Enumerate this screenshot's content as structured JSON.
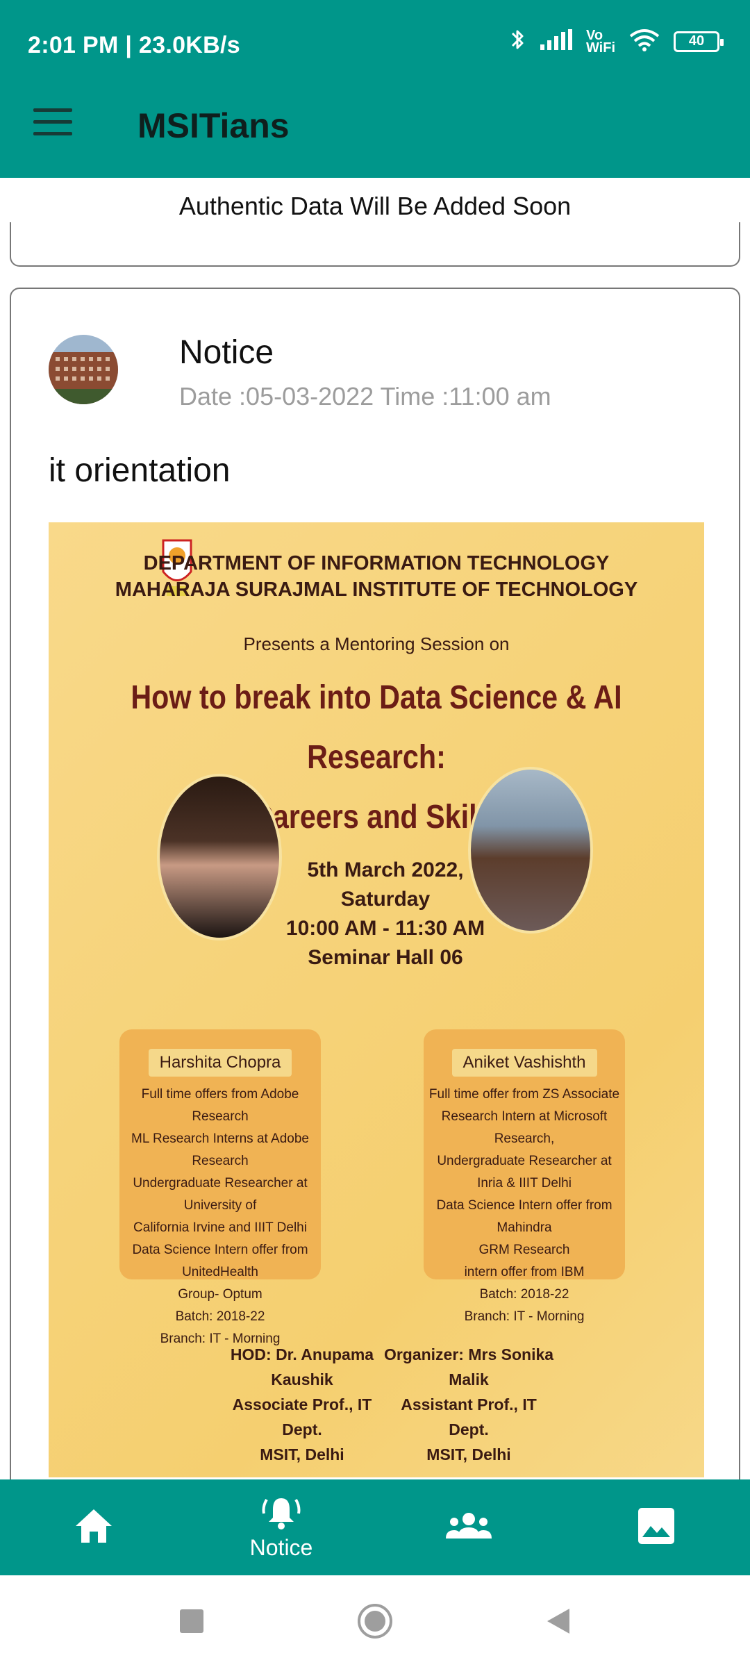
{
  "status_bar": {
    "time_speed": "2:01 PM | 23.0KB/s",
    "vowifi_top": "Vo",
    "vowifi_bottom": "WiFi",
    "battery": "40"
  },
  "app_bar": {
    "title": "MSITians",
    "menu_icon": "hamburger-menu-icon"
  },
  "banner": {
    "text": "Authentic Data Will Be Added Soon"
  },
  "notice_card": {
    "title": "Notice",
    "date": "Date :05-03-2022 Time :11:00 am",
    "body": "it orientation",
    "poster": {
      "dept_line1": "DEPARTMENT OF INFORMATION TECHNOLOGY",
      "dept_line2": "MAHARAJA SURAJMAL INSTITUTE OF TECHNOLOGY",
      "presents": "Presents a Mentoring Session on",
      "headline1": "How to break into Data Science & AI Research:",
      "headline2": "Careers and Skills",
      "date": "5th March 2022, Saturday",
      "time": "10:00 AM - 11:30 AM",
      "venue": "Seminar Hall 06",
      "speaker_left": {
        "name": "Harshita Chopra",
        "lines": [
          "Full time offers from Adobe Research",
          "ML Research Interns at Adobe Research",
          "Undergraduate Researcher at University of",
          "California Irvine and IIIT Delhi",
          "Data Science Intern offer from UnitedHealth",
          "Group- Optum",
          "Batch: 2018-22",
          "Branch: IT - Morning"
        ]
      },
      "speaker_right": {
        "name": "Aniket Vashishth",
        "lines": [
          "Full time offer from ZS Associate",
          "Research Intern at Microsoft Research,",
          "Undergraduate Researcher at Inria & IIIT Delhi",
          "Data Science Intern offer from Mahindra",
          "GRM Research",
          "intern offer from IBM",
          "Batch: 2018-22",
          "Branch: IT - Morning"
        ]
      },
      "footer_left": [
        "HOD: Dr. Anupama Kaushik",
        "Associate Prof., IT Dept.",
        "MSIT, Delhi"
      ],
      "footer_right": [
        "Organizer: Mrs Sonika Malik",
        "Assistant Prof., IT Dept.",
        "MSIT, Delhi"
      ]
    }
  },
  "bottom_nav": {
    "items": [
      {
        "icon": "home-icon",
        "label": ""
      },
      {
        "icon": "notification-bell-icon",
        "label": "Notice",
        "active": true
      },
      {
        "icon": "group-icon",
        "label": ""
      },
      {
        "icon": "image-gallery-icon",
        "label": ""
      }
    ]
  },
  "colors": {
    "primary": "#00968a",
    "poster_bg": "#f6d37a",
    "speaker_box": "#f0b354"
  }
}
